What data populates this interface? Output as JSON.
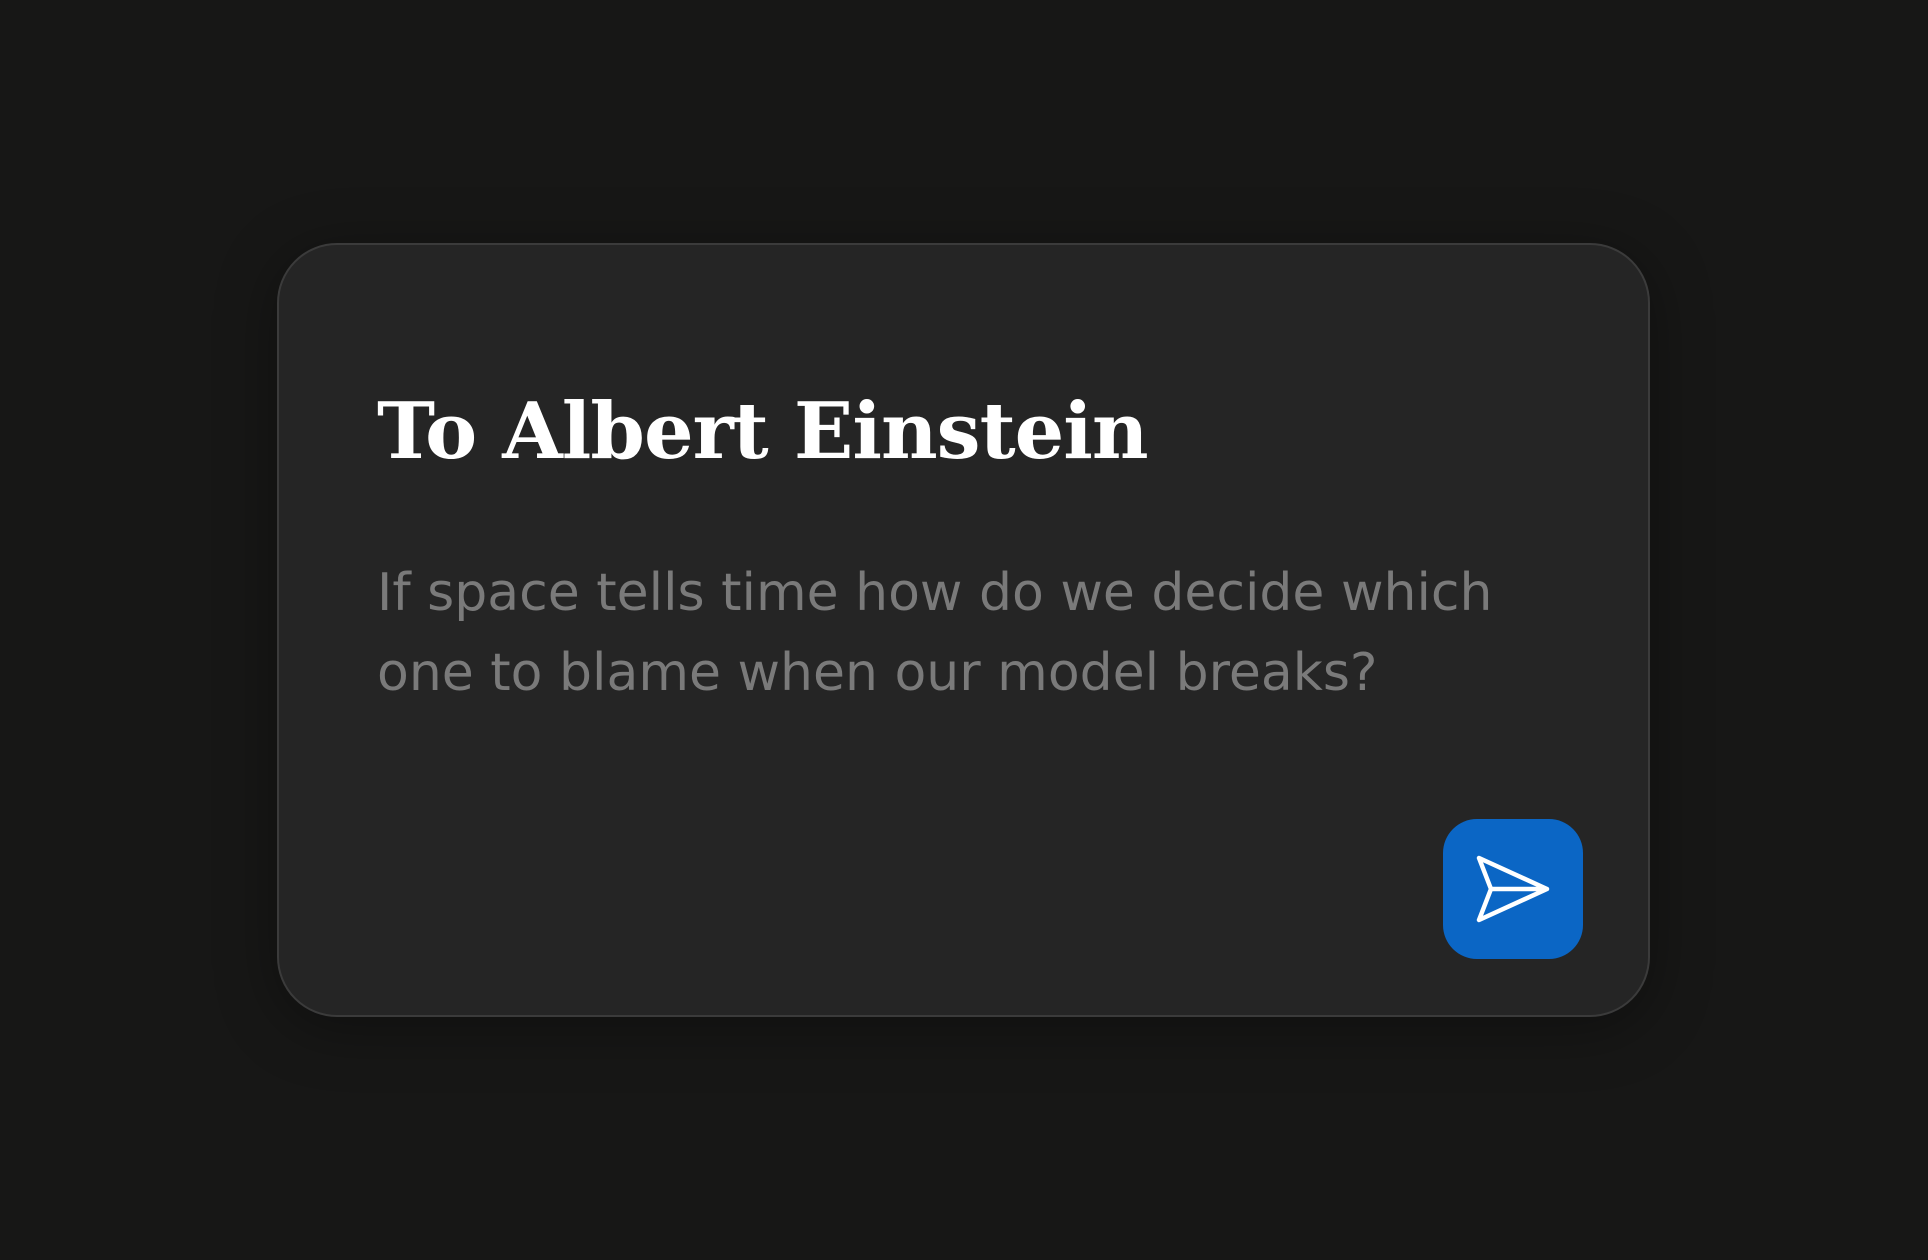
{
  "card": {
    "title": "To Albert Einstein",
    "message": "If space tells time how do we decide which one to blame when our model breaks?"
  },
  "send_button": {
    "icon": "send-icon",
    "color": "#0b66c5"
  },
  "colors": {
    "background": "#171716",
    "card": "#252525",
    "title": "#ffffff",
    "message": "#7a7a7a"
  }
}
